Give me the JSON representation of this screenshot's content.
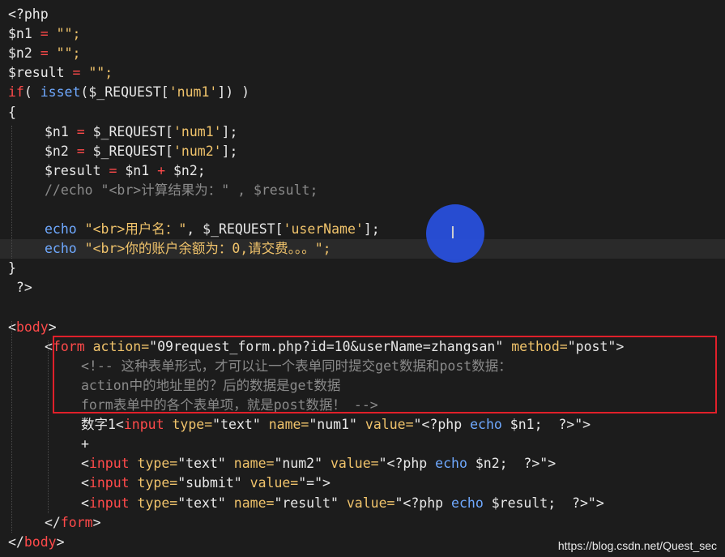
{
  "colors": {
    "background": "#1c1c1c",
    "default": "#e8e8e8",
    "keyword": "#ff4a4a",
    "operator": "#ff4a4a",
    "string": "#f0c36b",
    "function": "#6fa9ff",
    "comment": "#8a8a8a",
    "tag": "#ff4a4a",
    "attr": "#f0c36b",
    "highlight_border": "#e0202a",
    "cursor_circle": "#2850e1"
  },
  "code_lines": [
    {
      "indent": 0,
      "tokens": [
        {
          "t": "<?php",
          "c": "default"
        }
      ]
    },
    {
      "indent": 0,
      "tokens": [
        {
          "t": "$n1 ",
          "c": "default"
        },
        {
          "t": "=",
          "c": "operator"
        },
        {
          "t": " \"\";",
          "c": "string"
        }
      ]
    },
    {
      "indent": 0,
      "tokens": [
        {
          "t": "$n2 ",
          "c": "default"
        },
        {
          "t": "=",
          "c": "operator"
        },
        {
          "t": " \"\";",
          "c": "string"
        }
      ]
    },
    {
      "indent": 0,
      "tokens": [
        {
          "t": "$result ",
          "c": "default"
        },
        {
          "t": "=",
          "c": "operator"
        },
        {
          "t": " \"\";",
          "c": "string"
        }
      ]
    },
    {
      "indent": 0,
      "tokens": [
        {
          "t": "if",
          "c": "keyword"
        },
        {
          "t": "( ",
          "c": "default"
        },
        {
          "t": "isset",
          "c": "function"
        },
        {
          "t": "($_REQUEST[",
          "c": "default"
        },
        {
          "t": "'num1'",
          "c": "string"
        },
        {
          "t": "]) )",
          "c": "default"
        }
      ]
    },
    {
      "indent": 0,
      "tokens": [
        {
          "t": "{",
          "c": "default"
        }
      ]
    },
    {
      "indent": 1,
      "tokens": [
        {
          "t": "$n1 ",
          "c": "default"
        },
        {
          "t": "=",
          "c": "operator"
        },
        {
          "t": " $_REQUEST[",
          "c": "default"
        },
        {
          "t": "'num1'",
          "c": "string"
        },
        {
          "t": "];",
          "c": "default"
        }
      ]
    },
    {
      "indent": 1,
      "tokens": [
        {
          "t": "$n2 ",
          "c": "default"
        },
        {
          "t": "=",
          "c": "operator"
        },
        {
          "t": " $_REQUEST[",
          "c": "default"
        },
        {
          "t": "'num2'",
          "c": "string"
        },
        {
          "t": "];",
          "c": "default"
        }
      ]
    },
    {
      "indent": 1,
      "tokens": [
        {
          "t": "$result ",
          "c": "default"
        },
        {
          "t": "=",
          "c": "operator"
        },
        {
          "t": " $n1 ",
          "c": "default"
        },
        {
          "t": "+",
          "c": "operator"
        },
        {
          "t": " $n2;",
          "c": "default"
        }
      ]
    },
    {
      "indent": 1,
      "tokens": [
        {
          "t": "//echo \"<br>计算结果为：\" , $result;",
          "c": "comment"
        }
      ]
    },
    {
      "indent": 0,
      "tokens": []
    },
    {
      "indent": 1,
      "tokens": [
        {
          "t": "echo",
          "c": "function"
        },
        {
          "t": " \"<br>用户名：\"",
          "c": "string"
        },
        {
          "t": ", $_REQUEST[",
          "c": "default"
        },
        {
          "t": "'userName'",
          "c": "string"
        },
        {
          "t": "];",
          "c": "default"
        }
      ]
    },
    {
      "indent": 1,
      "current": true,
      "tokens": [
        {
          "t": "echo",
          "c": "function"
        },
        {
          "t": " \"<br>你的账户余额为：0,请交费。。。\";",
          "c": "string"
        }
      ]
    },
    {
      "indent": 0,
      "tokens": [
        {
          "t": "}",
          "c": "default"
        }
      ]
    },
    {
      "indent": 0,
      "tokens": [
        {
          "t": " ?>",
          "c": "default"
        }
      ]
    },
    {
      "indent": 0,
      "tokens": []
    },
    {
      "indent": 0,
      "tokens": [
        {
          "t": "<",
          "c": "default"
        },
        {
          "t": "body",
          "c": "tag"
        },
        {
          "t": ">",
          "c": "default"
        }
      ]
    },
    {
      "indent": 1,
      "tokens": [
        {
          "t": "<",
          "c": "default"
        },
        {
          "t": "form",
          "c": "tag"
        },
        {
          "t": " action=",
          "c": "attr"
        },
        {
          "t": "\"09request_form.php?id=10&userName=zhangsan\"",
          "c": "default"
        },
        {
          "t": " method=",
          "c": "attr"
        },
        {
          "t": "\"post\"",
          "c": "default"
        },
        {
          "t": ">",
          "c": "default"
        }
      ]
    },
    {
      "indent": 2,
      "tokens": [
        {
          "t": "<!-- 这种表单形式，才可以让一个表单同时提交get数据和post数据：",
          "c": "comment"
        }
      ]
    },
    {
      "indent": 2,
      "tokens": [
        {
          "t": "action中的地址里的？后的数据是get数据",
          "c": "comment"
        }
      ]
    },
    {
      "indent": 2,
      "tokens": [
        {
          "t": "form表单中的各个表单项，就是post数据！ -->",
          "c": "comment"
        }
      ]
    },
    {
      "indent": 2,
      "tokens": [
        {
          "t": "数字1<",
          "c": "default"
        },
        {
          "t": "input",
          "c": "tag"
        },
        {
          "t": " type=",
          "c": "attr"
        },
        {
          "t": "\"text\"",
          "c": "default"
        },
        {
          "t": " name=",
          "c": "attr"
        },
        {
          "t": "\"num1\"",
          "c": "default"
        },
        {
          "t": " value=",
          "c": "attr"
        },
        {
          "t": "\"<?php ",
          "c": "default"
        },
        {
          "t": "echo",
          "c": "function"
        },
        {
          "t": " $n1;  ?>\">",
          "c": "default"
        }
      ]
    },
    {
      "indent": 2,
      "tokens": [
        {
          "t": "+",
          "c": "default"
        }
      ]
    },
    {
      "indent": 2,
      "tokens": [
        {
          "t": "<",
          "c": "default"
        },
        {
          "t": "input",
          "c": "tag"
        },
        {
          "t": " type=",
          "c": "attr"
        },
        {
          "t": "\"text\"",
          "c": "default"
        },
        {
          "t": " name=",
          "c": "attr"
        },
        {
          "t": "\"num2\"",
          "c": "default"
        },
        {
          "t": " value=",
          "c": "attr"
        },
        {
          "t": "\"<?php ",
          "c": "default"
        },
        {
          "t": "echo",
          "c": "function"
        },
        {
          "t": " $n2;  ?>\">",
          "c": "default"
        }
      ]
    },
    {
      "indent": 2,
      "tokens": [
        {
          "t": "<",
          "c": "default"
        },
        {
          "t": "input",
          "c": "tag"
        },
        {
          "t": " type=",
          "c": "attr"
        },
        {
          "t": "\"submit\"",
          "c": "default"
        },
        {
          "t": " value=",
          "c": "attr"
        },
        {
          "t": "\"=\">",
          "c": "default"
        }
      ]
    },
    {
      "indent": 2,
      "tokens": [
        {
          "t": "<",
          "c": "default"
        },
        {
          "t": "input",
          "c": "tag"
        },
        {
          "t": " type=",
          "c": "attr"
        },
        {
          "t": "\"text\"",
          "c": "default"
        },
        {
          "t": " name=",
          "c": "attr"
        },
        {
          "t": "\"result\"",
          "c": "default"
        },
        {
          "t": " value=",
          "c": "attr"
        },
        {
          "t": "\"<?php ",
          "c": "default"
        },
        {
          "t": "echo",
          "c": "function"
        },
        {
          "t": " $result;  ?>\">",
          "c": "default"
        }
      ]
    },
    {
      "indent": 1,
      "tokens": [
        {
          "t": "</",
          "c": "default"
        },
        {
          "t": "form",
          "c": "tag"
        },
        {
          "t": ">",
          "c": "default"
        }
      ]
    },
    {
      "indent": 0,
      "tokens": [
        {
          "t": "</",
          "c": "default"
        },
        {
          "t": "body",
          "c": "tag"
        },
        {
          "t": ">",
          "c": "default"
        }
      ]
    }
  ],
  "cursor": {
    "glyph": "I"
  },
  "watermark": "https://blog.csdn.net/Quest_sec"
}
